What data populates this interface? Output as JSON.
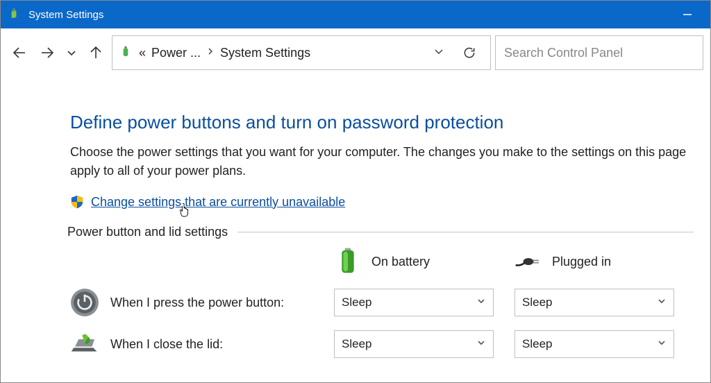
{
  "titlebar": {
    "title": "System Settings"
  },
  "breadcrumb": {
    "truncated_prefix": "«",
    "parent": "Power ...",
    "current": "System Settings"
  },
  "search": {
    "placeholder": "Search Control Panel"
  },
  "page": {
    "heading": "Define power buttons and turn on password protection",
    "description": "Choose the power settings that you want for your computer. The changes you make to the settings on this page apply to all of your power plans.",
    "change_link": "Change settings that are currently unavailable",
    "section_label": "Power button and lid settings"
  },
  "columns": {
    "battery": "On battery",
    "plugged": "Plugged in"
  },
  "rows": {
    "power_button": {
      "label": "When I press the power button:",
      "battery_value": "Sleep",
      "plugged_value": "Sleep"
    },
    "lid": {
      "label": "When I close the lid:",
      "battery_value": "Sleep",
      "plugged_value": "Sleep"
    }
  }
}
